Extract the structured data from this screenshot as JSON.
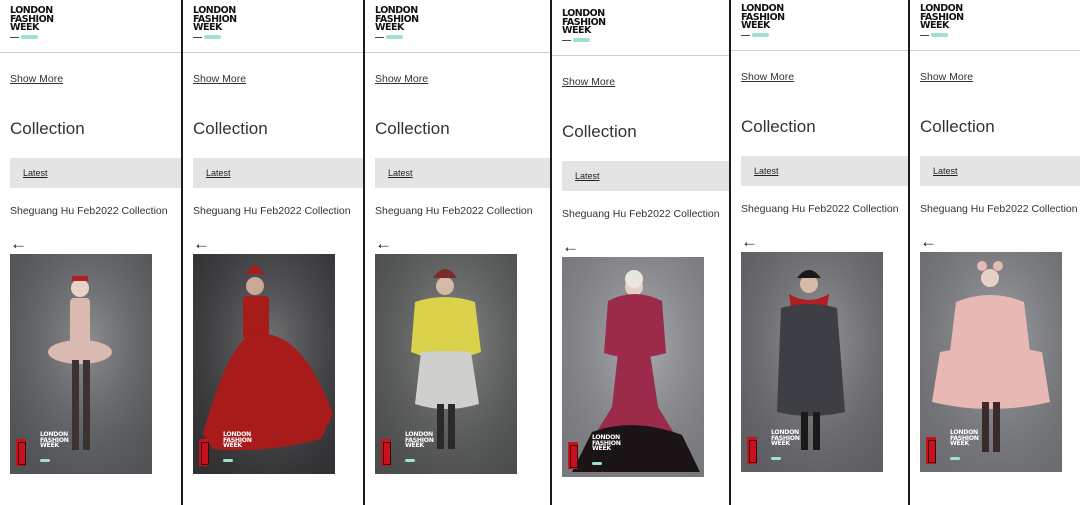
{
  "brand": {
    "logo_lines": [
      "LONDON",
      "FASHION",
      "WEEK"
    ]
  },
  "page": {
    "show_more": "Show More",
    "collection_heading": "Collection",
    "latest_tab": "Latest",
    "collection_name": "Sheguang Hu Feb2022 Collection",
    "back_arrow": "←"
  },
  "colors": {
    "text": "#333333",
    "tab_bar": "#e4e4e4",
    "divider": "#1c1c1c",
    "badge_red": "#c8101e",
    "logo_accent": "#9ee3c6"
  },
  "looks": [
    {
      "garment": "pale pink ruffled peplum corset with sheer tights",
      "garment_color": "#d9b9b0",
      "background": "#5f6265"
    },
    {
      "garment": "voluminous red tulle ballgown",
      "garment_color": "#a81b1b",
      "background": "#3a3a3d"
    },
    {
      "garment": "yellow ruffled blouse over grey tulle skirt",
      "garment_color": "#d9d24a",
      "background": "#5a5c5c"
    },
    {
      "garment": "magenta puff-sleeve mermaid gown with black tulle",
      "garment_color": "#9c2a4a",
      "background": "#8d8e92"
    },
    {
      "garment": "plaid coat with red ruff collar",
      "garment_color": "#3d3f45",
      "background": "#6e6f73"
    },
    {
      "garment": "pink pleated tiered dress",
      "garment_color": "#e8b9b4",
      "background": "#7e8084"
    }
  ]
}
